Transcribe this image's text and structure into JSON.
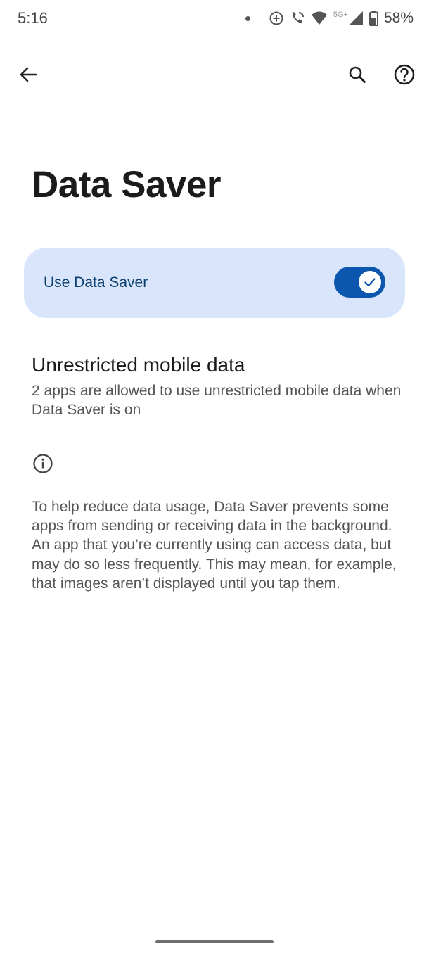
{
  "status_bar": {
    "time": "5:16",
    "network_label": "5G+",
    "battery": "58%"
  },
  "top_bar": {
    "back_icon": "arrow-back-icon",
    "search_icon": "search-icon",
    "help_icon": "help-icon"
  },
  "page": {
    "title": "Data Saver"
  },
  "main_switch": {
    "label": "Use Data Saver",
    "checked": true
  },
  "unrestricted": {
    "title": "Unrestricted mobile data",
    "summary": "2 apps are allowed to use unrestricted mobile data when Data Saver is on"
  },
  "footer": {
    "icon": "info-icon",
    "text": "To help reduce data usage, Data Saver prevents some apps from sending or receiving data in the background. An app that you’re currently using can access data, but may do so less frequently. This may mean, for example, that images aren’t displayed until you tap them."
  },
  "colors": {
    "accent": "#0b57b0",
    "switch_card_bg": "#d8e5fb",
    "switch_label": "#0d3f6e"
  }
}
